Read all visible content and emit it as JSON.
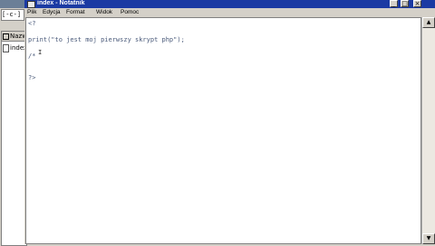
{
  "background_window": {
    "path": "[-c-]",
    "column_header": "Nazw",
    "file": "index"
  },
  "notepad": {
    "title": "index - Notatnik",
    "buttons": {
      "minimize": "_",
      "maximize": "□",
      "close": "×"
    },
    "menu": [
      "Plik",
      "Edycja",
      "Format",
      "Widok",
      "Pomoc"
    ],
    "lines": [
      "<?",
      "print(\"to jest moj pierwszy skrypt php\");",
      "/*",
      "?>"
    ],
    "cursor": "I"
  }
}
